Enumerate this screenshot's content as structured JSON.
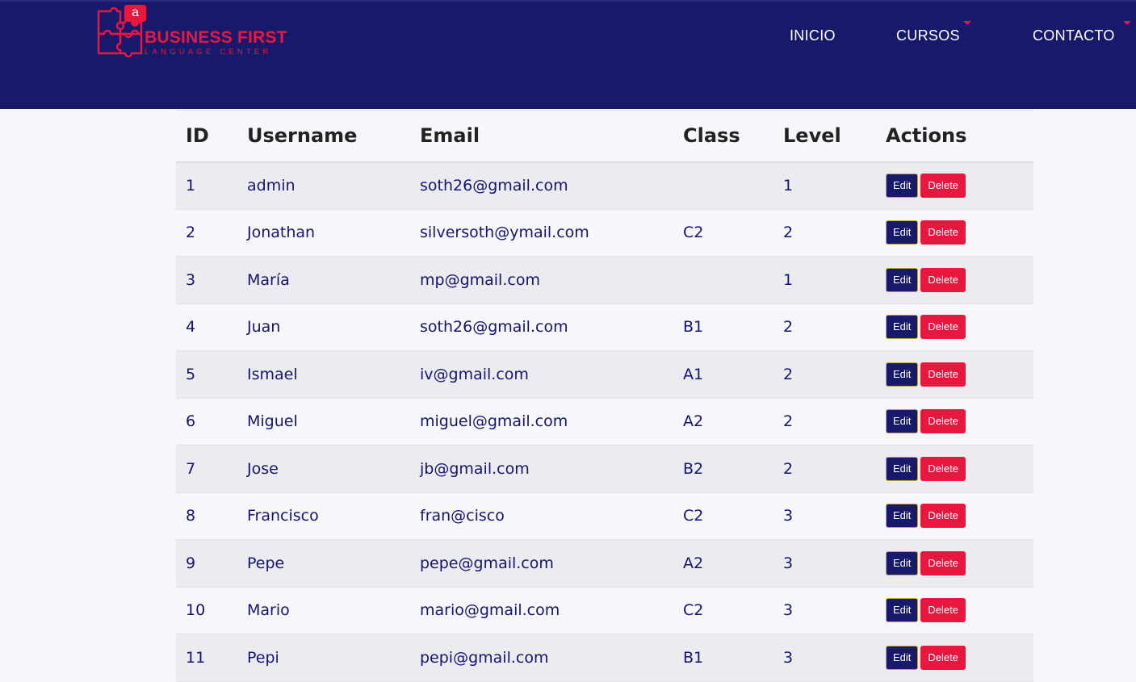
{
  "brand": {
    "name": "BUSINESS FIRST",
    "subtitle": "LANGUAGE CENTER",
    "logo_letter": "a",
    "color": "#e8173f"
  },
  "nav": {
    "items": [
      {
        "label": "INICIO",
        "has_dropdown": false
      },
      {
        "label": "CURSOS",
        "has_dropdown": true
      },
      {
        "label": "CONTACTO",
        "has_dropdown": true
      }
    ]
  },
  "table": {
    "headers": [
      "ID",
      "Username",
      "Email",
      "Class",
      "Level",
      "Actions"
    ],
    "edit_label": "Edit",
    "delete_label": "Delete",
    "rows": [
      {
        "id": "1",
        "username": "admin",
        "email": "soth26@gmail.com",
        "class": "",
        "level": "1"
      },
      {
        "id": "2",
        "username": "Jonathan",
        "email": "silversoth@ymail.com",
        "class": "C2",
        "level": "2"
      },
      {
        "id": "3",
        "username": "María",
        "email": "mp@gmail.com",
        "class": "",
        "level": "1"
      },
      {
        "id": "4",
        "username": "Juan",
        "email": "soth26@gmail.com",
        "class": "B1",
        "level": "2"
      },
      {
        "id": "5",
        "username": "Ismael",
        "email": "iv@gmail.com",
        "class": "A1",
        "level": "2"
      },
      {
        "id": "6",
        "username": "Miguel",
        "email": "miguel@gmail.com",
        "class": "A2",
        "level": "2"
      },
      {
        "id": "7",
        "username": "Jose",
        "email": "jb@gmail.com",
        "class": "B2",
        "level": "2"
      },
      {
        "id": "8",
        "username": "Francisco",
        "email": "fran@cisco",
        "class": "C2",
        "level": "3"
      },
      {
        "id": "9",
        "username": "Pepe",
        "email": "pepe@gmail.com",
        "class": "A2",
        "level": "3"
      },
      {
        "id": "10",
        "username": "Mario",
        "email": "mario@gmail.com",
        "class": "C2",
        "level": "3"
      },
      {
        "id": "11",
        "username": "Pepi",
        "email": "pepi@gmail.com",
        "class": "B1",
        "level": "3"
      }
    ]
  },
  "colors": {
    "navbar": "#19196b",
    "accent": "#e8173f",
    "text": "#151570"
  }
}
